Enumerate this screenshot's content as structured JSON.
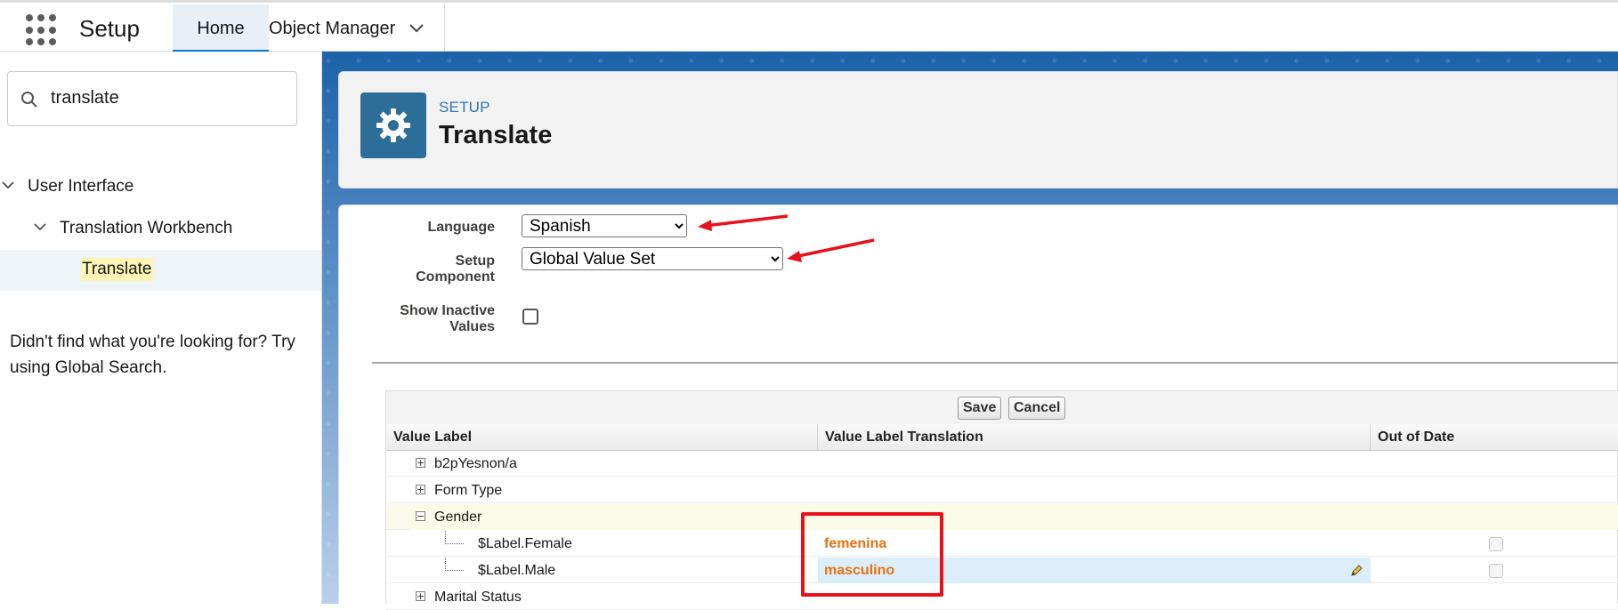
{
  "topbar": {
    "app_title": "Setup",
    "tabs": [
      {
        "label": "Home"
      },
      {
        "label": "Object Manager"
      }
    ]
  },
  "sidebar": {
    "search": {
      "value": "translate"
    },
    "tree": [
      {
        "label": "User Interface"
      },
      {
        "label": "Translation Workbench"
      },
      {
        "label": "Translate"
      }
    ],
    "help_text": "Didn't find what you're looking for? Try using Global Search."
  },
  "header": {
    "eyebrow": "SETUP",
    "title": "Translate",
    "icon": "gear-icon"
  },
  "form": {
    "language_label": "Language",
    "language_value": "Spanish",
    "component_label": "Setup Component",
    "component_value": "Global Value Set",
    "inactive_label": "Show Inactive Values",
    "inactive_checked": false
  },
  "grid": {
    "save_label": "Save",
    "cancel_label": "Cancel",
    "columns": [
      "Value Label",
      "Value Label Translation",
      "Out of Date"
    ],
    "rows": [
      {
        "label": "b2pYesnon/a",
        "expander": "+"
      },
      {
        "label": "Form Type",
        "expander": "+"
      },
      {
        "label": "Gender",
        "expander": "−"
      },
      {
        "label": "$Label.Female",
        "translation": "femenina",
        "out_of_date": false
      },
      {
        "label": "$Label.Male",
        "translation": "masculino",
        "out_of_date": false
      },
      {
        "label": "Marital Status",
        "expander": "+"
      }
    ]
  },
  "colors": {
    "accent_blue": "#0176d3",
    "header_icon_bg": "#2c6e98",
    "translation_text": "#e8700e",
    "annotation_red": "#e8111b"
  }
}
